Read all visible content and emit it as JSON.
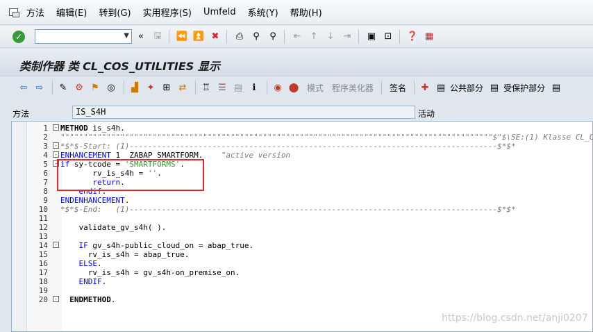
{
  "menu": [
    "方法",
    "编辑(E)",
    "转到(G)",
    "实用程序(S)",
    "Umfeld",
    "系统(Y)",
    "帮助(H)"
  ],
  "toolbar": {
    "command_value": "",
    "back_chevrons": "«"
  },
  "title": "类制作器 类 CL_COS_UTILITIES 显示",
  "apptoolbar": {
    "mode": "模式",
    "pretty": "程序美化器",
    "sign": "签名",
    "public": "公共部分",
    "protected": "受保护部分"
  },
  "method": {
    "label": "方法",
    "value": "IS_S4H",
    "status": "活动"
  },
  "code_lines": [
    {
      "n": "1",
      "fold": "-",
      "html": "<span class='kwb'>METHOD</span> is_s4h."
    },
    {
      "n": "2",
      "fold": "",
      "html": "<span class='cm'>\"\"\"\"\"\"\"\"\"\"\"\"\"\"\"\"\"\"\"\"\"\"\"\"\"\"\"\"\"\"\"\"\"\"\"\"\"\"\"\"\"\"\"\"\"\"\"\"\"\"\"\"\"\"\"\"\"\"\"\"\"\"\"\"\"\"\"\"\"\"\"\"\"\"\"\"\"\"\"\"\"\"\"\"\"\"\"\"\"\"\"\"\"\"$\"$\\SE:(1) Klasse CL_C</span>"
    },
    {
      "n": "3",
      "fold": "-",
      "html": "<span class='cm'>*$*$-Start: (1)--------------------------------------------------------------------------------$*$*</span>"
    },
    {
      "n": "4",
      "fold": "-",
      "html": "<span class='kw'>ENHANCEMENT</span> 1  ZABAP_SMARTFORM.    <span class='cm'>\"active version</span>"
    },
    {
      "n": "5",
      "fold": "-",
      "html": "<span class='kw'>if</span> sy-tcode = <span class='str'>'SMARTFORMS'</span>."
    },
    {
      "n": "6",
      "fold": "",
      "html": "       rv_is_s4h = <span class='str'>''</span>."
    },
    {
      "n": "7",
      "fold": "",
      "html": "       <span class='kw'>return</span>."
    },
    {
      "n": "8",
      "fold": "",
      "html": "    <span class='kw'>endif</span>."
    },
    {
      "n": "9",
      "fold": "",
      "html": "<span class='kw'>ENDENHANCEMENT</span>."
    },
    {
      "n": "10",
      "fold": "",
      "html": "<span class='cm'>*$*$-End:   (1)--------------------------------------------------------------------------------$*$*</span>"
    },
    {
      "n": "11",
      "fold": "",
      "html": ""
    },
    {
      "n": "12",
      "fold": "",
      "html": "    validate_gv_s4h( )."
    },
    {
      "n": "13",
      "fold": "",
      "html": ""
    },
    {
      "n": "14",
      "fold": "-",
      "html": "    <span class='kw'>IF</span> gv_s4h-public_cloud_on = abap_true."
    },
    {
      "n": "15",
      "fold": "",
      "html": "      rv_is_s4h = abap_true."
    },
    {
      "n": "16",
      "fold": "",
      "html": "    <span class='kw'>ELSE</span>."
    },
    {
      "n": "17",
      "fold": "",
      "html": "      rv_is_s4h = gv_s4h-on_premise_on."
    },
    {
      "n": "18",
      "fold": "",
      "html": "    <span class='kw'>ENDIF</span>."
    },
    {
      "n": "19",
      "fold": "",
      "html": ""
    },
    {
      "n": "20",
      "fold": "-",
      "html": "  <span class='kwb'>ENDMETHOD</span>."
    }
  ],
  "watermark": "https://blog.csdn.net/anji0207"
}
